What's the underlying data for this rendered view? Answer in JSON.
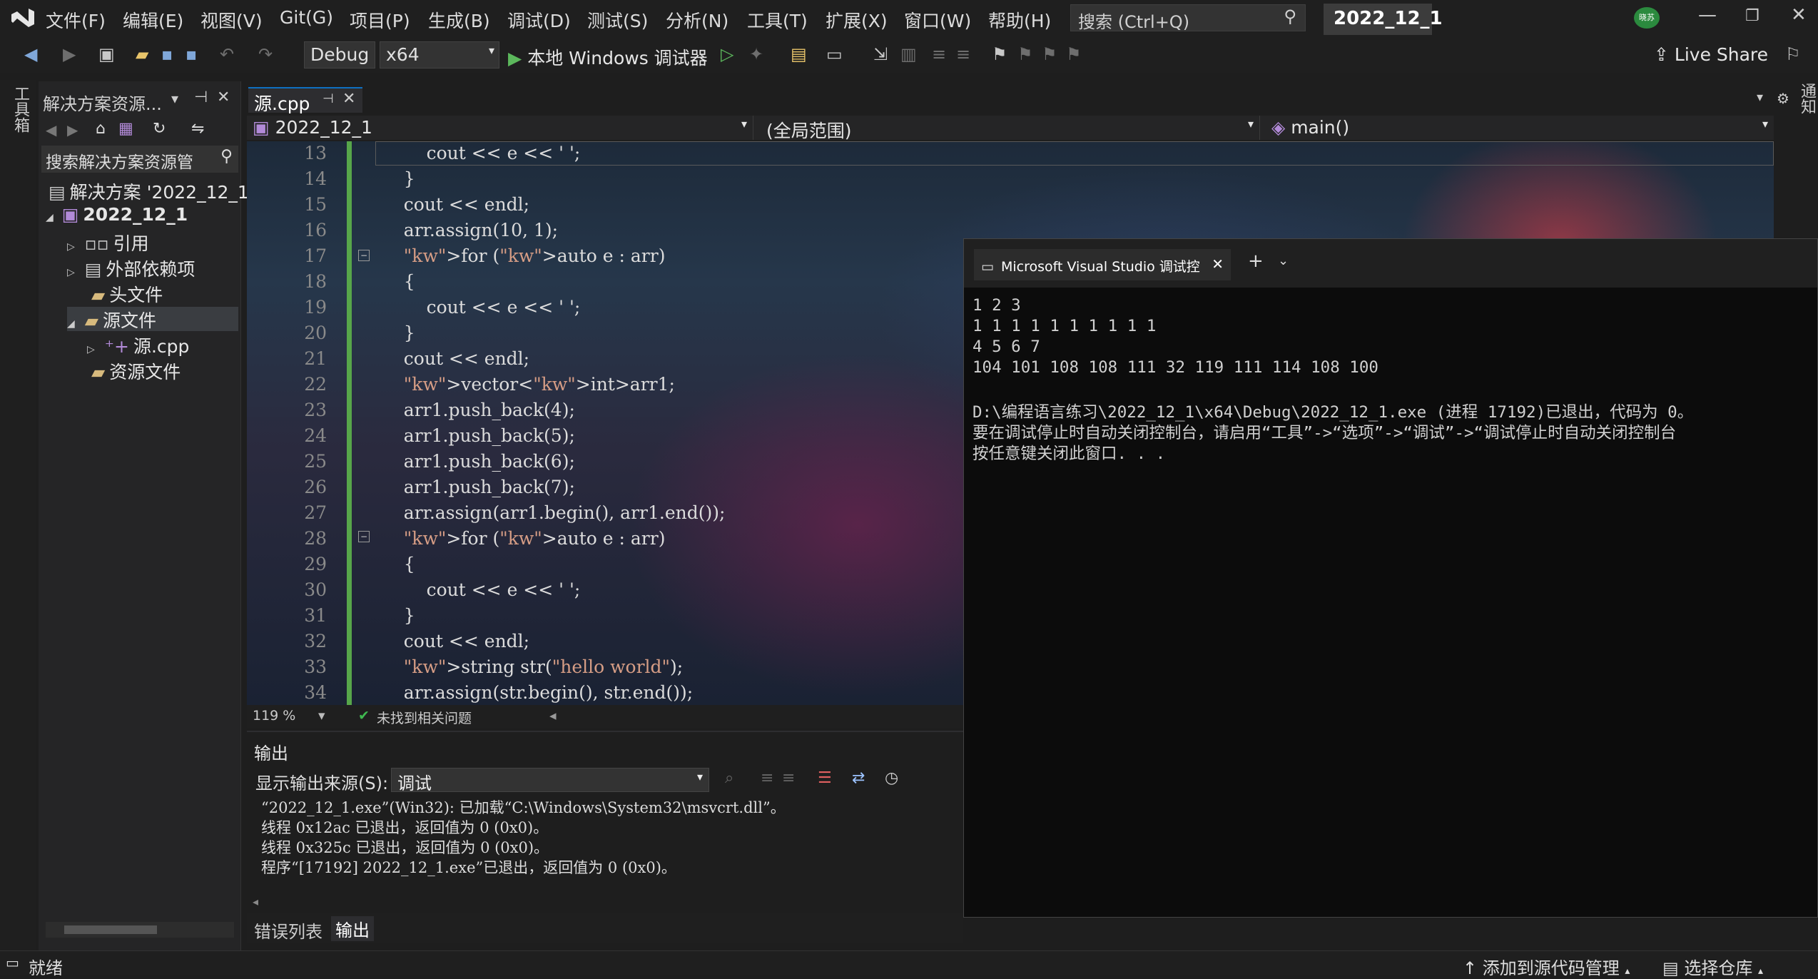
{
  "menubar": {
    "items": [
      "文件(F)",
      "编辑(E)",
      "视图(V)",
      "Git(G)",
      "项目(P)",
      "生成(B)",
      "调试(D)",
      "测试(S)",
      "分析(N)",
      "工具(T)",
      "扩展(X)",
      "窗口(W)",
      "帮助(H)"
    ],
    "search_label": "搜索 (Ctrl+Q)",
    "solution_name": "2022_12_1",
    "avatar_text": "晓苏"
  },
  "toolbar": {
    "config": "Debug",
    "platform": "x64",
    "run_label": "本地 Windows 调试器",
    "live_share": "Live Share"
  },
  "left_strip": {
    "label": "工具箱"
  },
  "right_strip": {
    "label": "通知"
  },
  "solution_explorer": {
    "title": "解决方案资源...",
    "search_placeholder": "搜索解决方案资源管",
    "items": [
      {
        "label": "解决方案 '2022_12_1"
      },
      {
        "label": "2022_12_1"
      },
      {
        "label": "引用"
      },
      {
        "label": "外部依赖项"
      },
      {
        "label": "头文件"
      },
      {
        "label": "源文件"
      },
      {
        "label": "源.cpp"
      },
      {
        "label": "资源文件"
      }
    ]
  },
  "editor": {
    "tab": "源.cpp",
    "nav_project": "2022_12_1",
    "nav_scope": "(全局范围)",
    "nav_member": "main()",
    "zoom": "119 %",
    "issues": "未找到相关问题",
    "lines": [
      {
        "n": "13",
        "code": "        cout << e << ' ';"
      },
      {
        "n": "14",
        "code": "    }"
      },
      {
        "n": "15",
        "code": "    cout << endl;"
      },
      {
        "n": "16",
        "code": "    arr.assign(10, 1);"
      },
      {
        "n": "17",
        "code": "    for (auto e : arr)"
      },
      {
        "n": "18",
        "code": "    {"
      },
      {
        "n": "19",
        "code": "        cout << e << ' ';"
      },
      {
        "n": "20",
        "code": "    }"
      },
      {
        "n": "21",
        "code": "    cout << endl;"
      },
      {
        "n": "22",
        "code": "    vector<int>arr1;"
      },
      {
        "n": "23",
        "code": "    arr1.push_back(4);"
      },
      {
        "n": "24",
        "code": "    arr1.push_back(5);"
      },
      {
        "n": "25",
        "code": "    arr1.push_back(6);"
      },
      {
        "n": "26",
        "code": "    arr1.push_back(7);"
      },
      {
        "n": "27",
        "code": "    arr.assign(arr1.begin(), arr1.end());"
      },
      {
        "n": "28",
        "code": "    for (auto e : arr)"
      },
      {
        "n": "29",
        "code": "    {"
      },
      {
        "n": "30",
        "code": "        cout << e << ' ';"
      },
      {
        "n": "31",
        "code": "    }"
      },
      {
        "n": "32",
        "code": "    cout << endl;"
      },
      {
        "n": "33",
        "code": "    string str(\"hello world\");"
      },
      {
        "n": "34",
        "code": "    arr.assign(str.begin(), str.end());"
      }
    ]
  },
  "console": {
    "tab_title": "Microsoft Visual Studio 调试控",
    "lines": [
      "1 2 3",
      "1 1 1 1 1 1 1 1 1 1",
      "4 5 6 7",
      "104 101 108 108 111 32 119 111 114 108 100",
      "",
      "D:\\编程语言练习\\2022_12_1\\x64\\Debug\\2022_12_1.exe (进程 17192)已退出，代码为 0。",
      "要在调试停止时自动关闭控制台，请启用“工具”->“选项”->“调试”->“调试停止时自动关闭控制台",
      "按任意键关闭此窗口. . ."
    ]
  },
  "output": {
    "title": "输出",
    "source_label": "显示输出来源(S):",
    "source_value": "调试",
    "lines": [
      "“2022_12_1.exe”(Win32): 已加载“C:\\Windows\\System32\\msvcrt.dll”。",
      "线程 0x12ac 已退出，返回值为 0 (0x0)。",
      "线程 0x325c 已退出，返回值为 0 (0x0)。",
      "程序“[17192] 2022_12_1.exe”已退出，返回值为 0 (0x0)。"
    ],
    "tabs": [
      "错误列表",
      "输出"
    ]
  },
  "statusbar": {
    "ready": "就绪",
    "source_control": "添加到源代码管理",
    "repo": "选择仓库"
  }
}
